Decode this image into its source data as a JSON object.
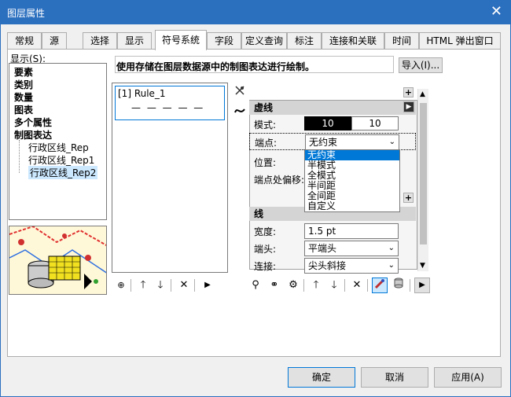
{
  "window": {
    "title": "图层属性",
    "close_glyph": "✕"
  },
  "tabs": [
    {
      "label": "常规"
    },
    {
      "label": "源"
    },
    {
      "label": "选择"
    },
    {
      "label": "显示"
    },
    {
      "label": "符号系统",
      "active": true
    },
    {
      "label": "字段"
    },
    {
      "label": "定义查询"
    },
    {
      "label": "标注"
    },
    {
      "label": "连接和关联"
    },
    {
      "label": "时间"
    },
    {
      "label": "HTML 弹出窗口"
    }
  ],
  "show": {
    "label": "显示(S):",
    "tree": [
      "要素",
      "类别",
      "数量",
      "图表",
      "多个属性",
      "制图表达",
      "行政区线_Rep",
      "行政区线_Rep1",
      "行政区线_Rep2"
    ]
  },
  "description": "使用存储在图层数据源中的制图表达进行绘制。",
  "import_button": "导入(I)...",
  "rule": {
    "name": "[1] Rule_1",
    "preview": "— — — — —"
  },
  "dash_section": {
    "title": "虚线",
    "pattern_label": "模式:",
    "pattern_values": [
      "10",
      "10"
    ],
    "endpoint_label": "端点:",
    "endpoint_value": "无约束",
    "position_label": "位置:",
    "offset_label": "端点处偏移:",
    "dropdown_options": [
      "无约束",
      "半模式",
      "全模式",
      "半间距",
      "全间距",
      "自定义"
    ]
  },
  "line_section": {
    "title": "线",
    "width_label": "宽度:",
    "width_value": "1.5 pt",
    "cap_label": "端头:",
    "cap_value": "平端头",
    "join_label": "连接:",
    "join_value": "尖头斜接"
  },
  "buttons": {
    "ok": "确定",
    "cancel": "取消",
    "apply": "应用(A)"
  }
}
